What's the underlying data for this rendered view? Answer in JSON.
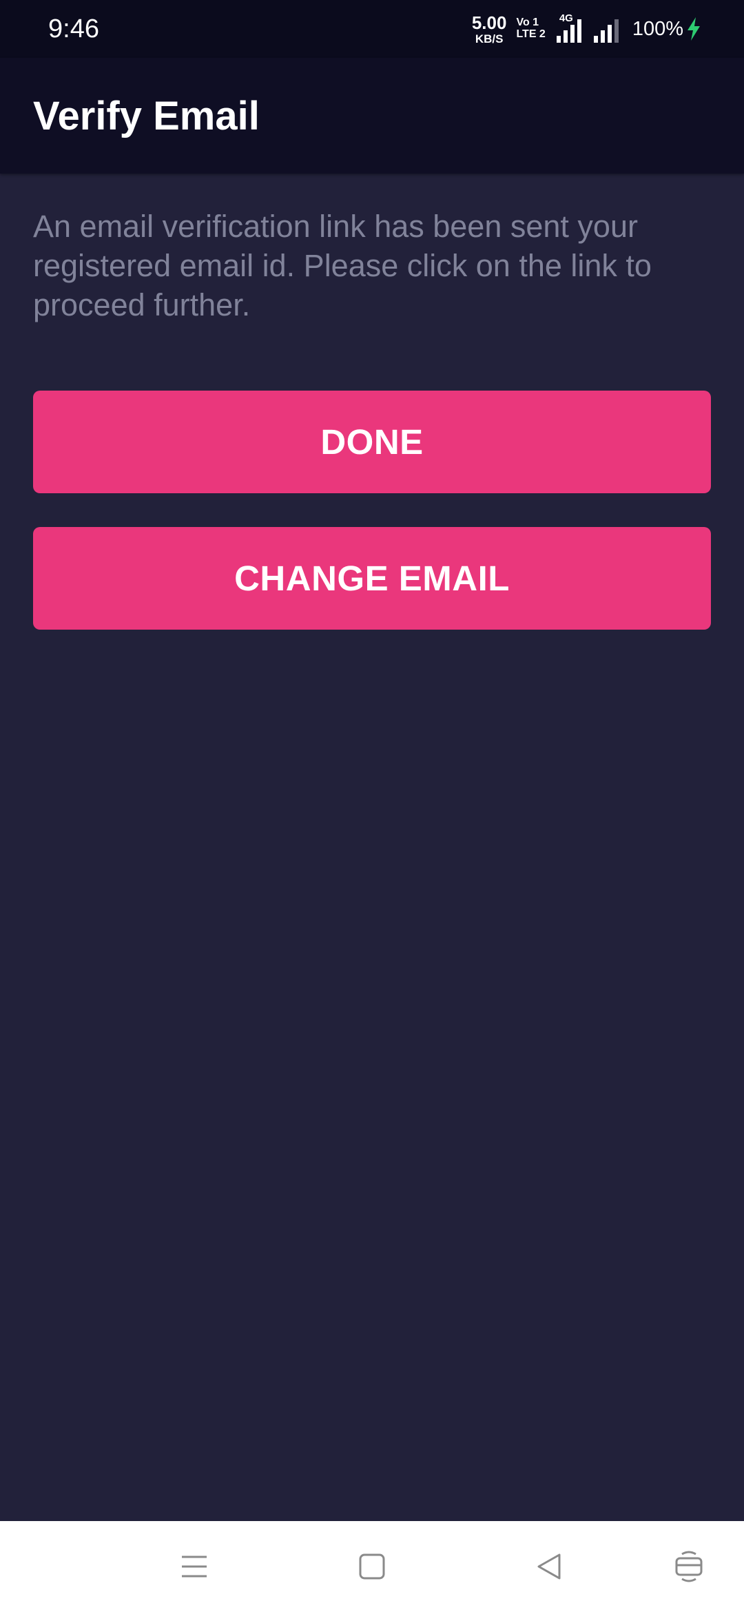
{
  "status_bar": {
    "time": "9:46",
    "speed_value": "5.00",
    "speed_unit": "KB/S",
    "volte_top": "Vo\u0001",
    "volte_line1": "Vo 1",
    "volte_line2": "LTE 2",
    "network_type": "4G",
    "battery": "100%",
    "icons": [
      "network-speed-icon",
      "volte-icon",
      "signal-4g-icon",
      "signal-icon",
      "charging-icon"
    ]
  },
  "app_bar": {
    "title": "Verify Email"
  },
  "content": {
    "message": "An email verification link has been sent your registered email id. Please click on the link to proceed further."
  },
  "buttons": {
    "done_label": "DONE",
    "change_email_label": "CHANGE EMAIL"
  },
  "nav_bar": {
    "icons": [
      "menu-icon",
      "home-icon",
      "back-icon",
      "screen-icon"
    ]
  },
  "colors": {
    "background": "#22213a",
    "app_bar": "#0f0e24",
    "status_bar": "#0b0b1d",
    "accent": "#ea377c",
    "message_text": "#81839a",
    "charging": "#2ecc71"
  }
}
